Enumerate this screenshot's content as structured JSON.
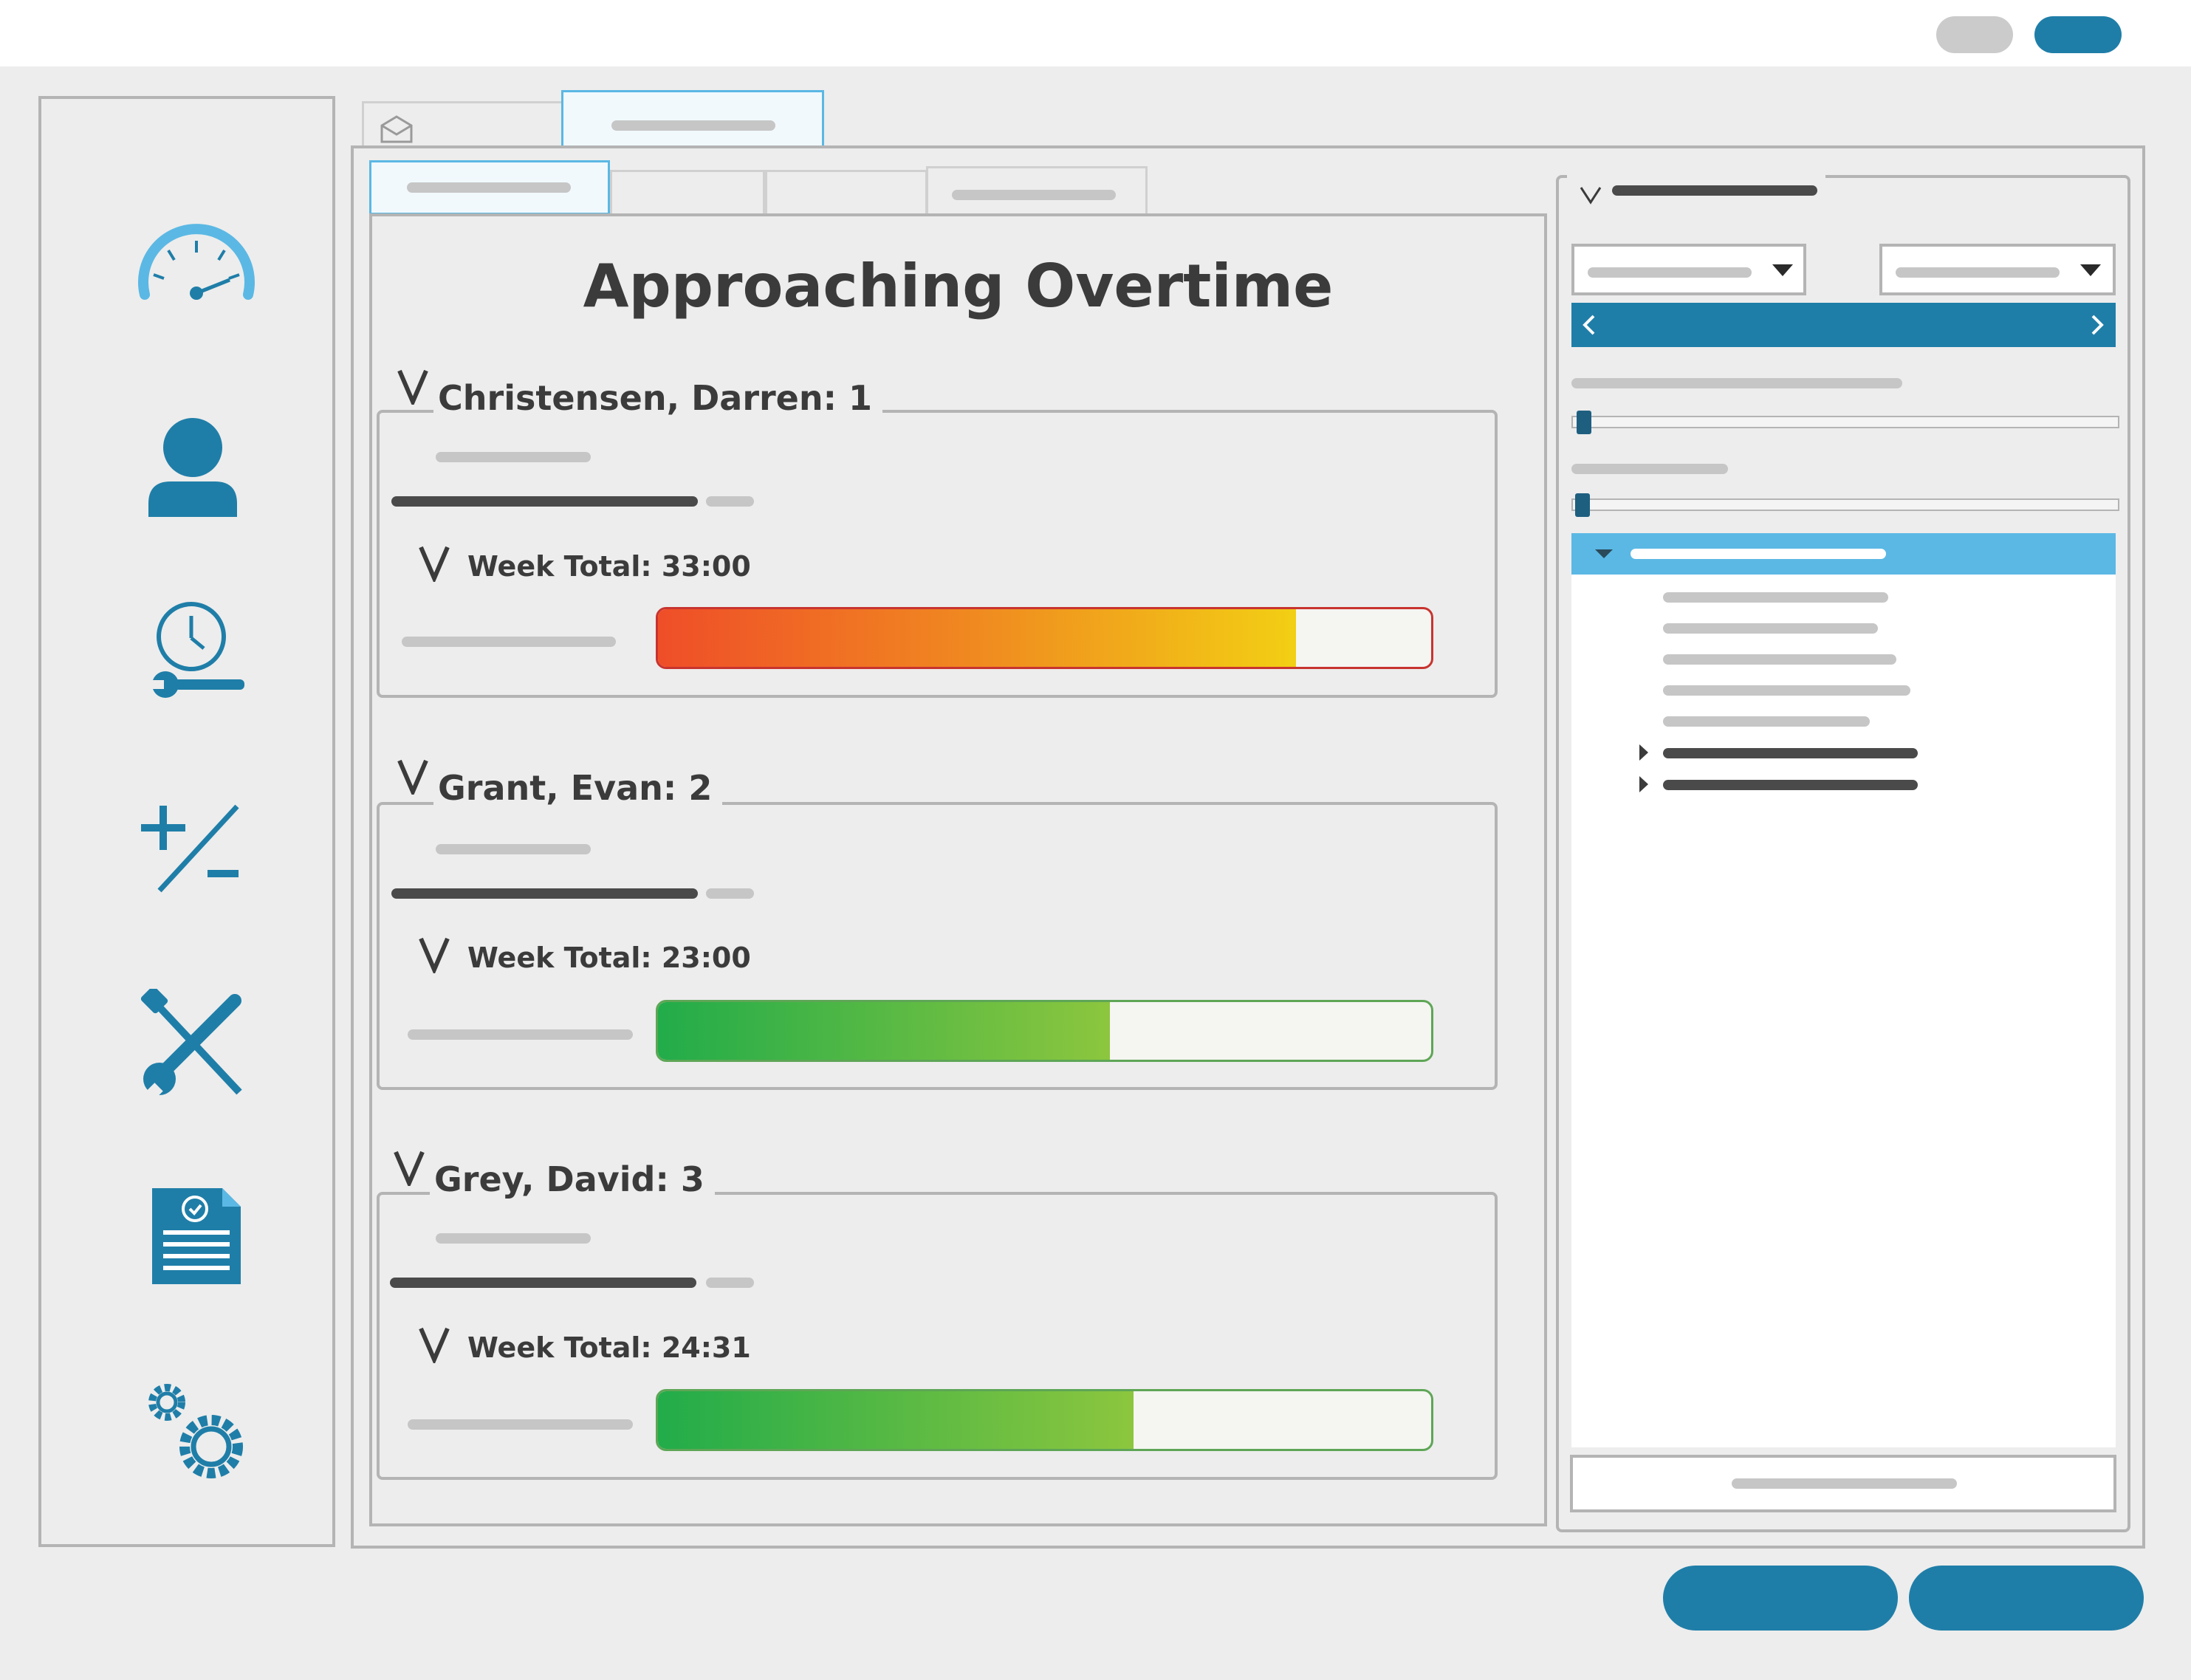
{
  "report": {
    "title": "Approaching Overtime",
    "max_hours": 40,
    "people": [
      {
        "title": "Christensen, Darren: 1",
        "week_label": "Week Total: 33:00",
        "progress": 0.825,
        "status": "warning"
      },
      {
        "title": "Grant, Evan: 2",
        "week_label": "Week Total: 23:00",
        "progress": 0.585,
        "status": "ok"
      },
      {
        "title": "Grey, David: 3",
        "week_label": "Week Total: 24:31",
        "progress": 0.615,
        "status": "ok"
      }
    ]
  },
  "sidebar": {
    "icons": [
      "dashboard-gauge-icon",
      "user-icon",
      "time-tools-icon",
      "adjustments-plus-minus-icon",
      "tools-icon",
      "approved-document-icon",
      "settings-gears-icon"
    ]
  },
  "colors": {
    "brand_blue": "#1f7ea8",
    "light_blue": "#5bb8e4",
    "warning_gradient": [
      "#ef4e28",
      "#f08a20",
      "#f2cf14"
    ],
    "ok_gradient": [
      "#22ac4a",
      "#8cc63e"
    ],
    "warning_border": "#c8342f",
    "ok_border": "#5ea656"
  }
}
